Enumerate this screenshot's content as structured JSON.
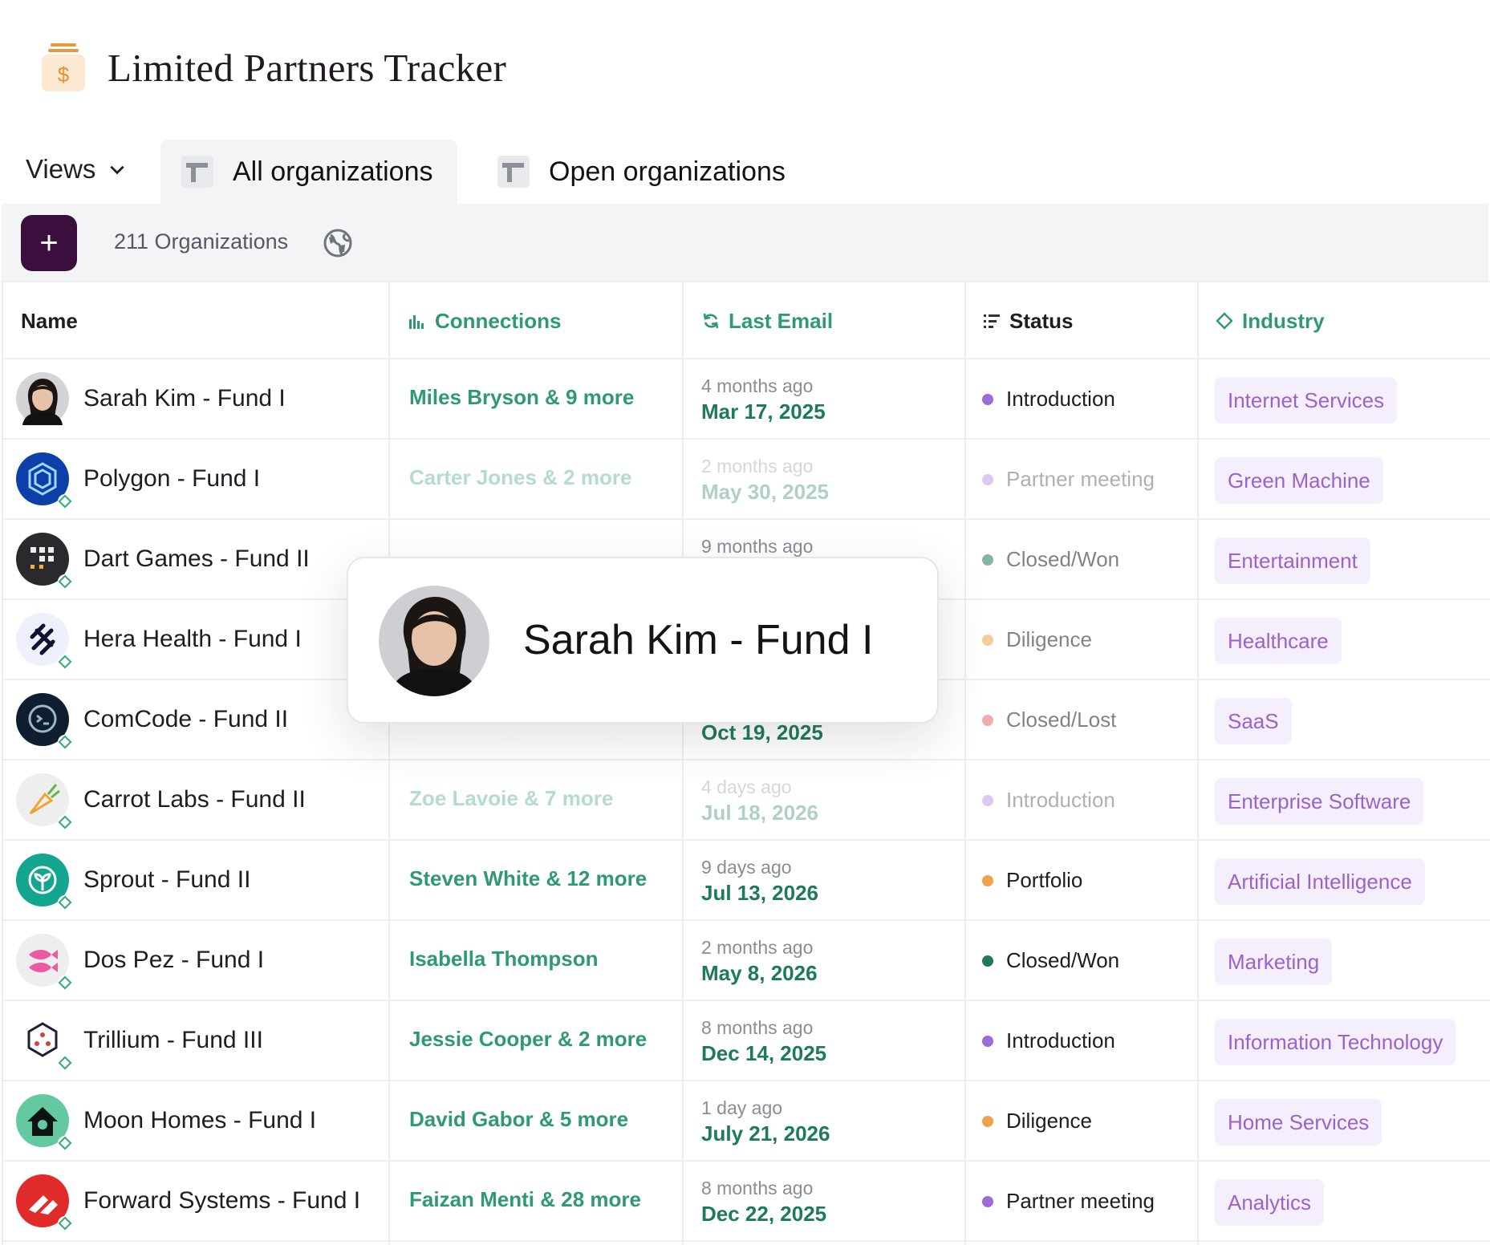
{
  "app": {
    "title": "Limited Partners Tracker",
    "icon": "money-bag-icon"
  },
  "tabs": {
    "views_label": "Views",
    "items": [
      {
        "label": "All organizations",
        "active": true
      },
      {
        "label": "Open organizations",
        "active": false
      }
    ]
  },
  "toolbar": {
    "add_label": "+",
    "count": "211 Organizations",
    "icon": "globe-icon"
  },
  "table": {
    "columns": [
      {
        "label": "Name",
        "icon": ""
      },
      {
        "label": "Connections",
        "icon": "bar-chart-icon"
      },
      {
        "label": "Last Email",
        "icon": "refresh-icon"
      },
      {
        "label": "Status",
        "icon": "list-status-icon"
      },
      {
        "label": "Industry",
        "icon": "diamond-icon"
      }
    ],
    "rows": [
      {
        "name": "Sarah Kim - Fund I",
        "connections": "Miles Bryson & 9 more",
        "relative": "4 months ago",
        "date": "Mar 17, 2025",
        "status": "Introduction",
        "status_color": "#9b6bd6",
        "industry": "Internet Services"
      },
      {
        "name": "Polygon - Fund I",
        "connections": "Carter Jones & 2 more",
        "relative": "2 months ago",
        "date": "May 30, 2025",
        "status": "Partner meeting",
        "status_color": "#9b6bd6",
        "industry": "Green Machine"
      },
      {
        "name": "Dart Games - Fund II",
        "connections": "",
        "relative": "9 months ago",
        "date": "",
        "status": "Closed/Won",
        "status_color": "#1f7a55",
        "industry": "Entertainment"
      },
      {
        "name": "Hera Health - Fund I",
        "connections": "",
        "relative": "",
        "date": "",
        "status": "Diligence",
        "status_color": "#f0a24a",
        "industry": "Healthcare"
      },
      {
        "name": "ComCode - Fund II",
        "connections": "",
        "relative": "",
        "date": "Oct 19, 2025",
        "status": "Closed/Lost",
        "status_color": "#e56a6a",
        "industry": "SaaS"
      },
      {
        "name": "Carrot Labs - Fund II",
        "connections": "Zoe Lavoie & 7 more",
        "relative": "4 days ago",
        "date": "Jul 18, 2026",
        "status": "Introduction",
        "status_color": "#9b6bd6",
        "industry": "Enterprise Software"
      },
      {
        "name": "Sprout - Fund II",
        "connections": "Steven White & 12 more",
        "relative": "9 days ago",
        "date": "Jul 13, 2026",
        "status": "Portfolio",
        "status_color": "#f0a24a",
        "industry": "Artificial Intelligence"
      },
      {
        "name": "Dos Pez - Fund I",
        "connections": "Isabella Thompson",
        "relative": "2 months ago",
        "date": "May 8, 2026",
        "status": "Closed/Won",
        "status_color": "#1f7a55",
        "industry": "Marketing"
      },
      {
        "name": "Trillium - Fund III",
        "connections": "Jessie Cooper & 2 more",
        "relative": "8 months ago",
        "date": "Dec 14, 2025",
        "status": "Introduction",
        "status_color": "#9b6bd6",
        "industry": "Information Technology"
      },
      {
        "name": "Moon Homes - Fund I",
        "connections": "David Gabor & 5 more",
        "relative": "1 day ago",
        "date": "July 21, 2026",
        "status": "Diligence",
        "status_color": "#f0a24a",
        "industry": "Home Services"
      },
      {
        "name": "Forward Systems - Fund I",
        "connections": "Faizan Menti & 28 more",
        "relative": "8 months ago",
        "date": "Dec 22, 2025",
        "status": "Partner meeting",
        "status_color": "#9b6bd6",
        "industry": "Analytics"
      }
    ]
  },
  "popover": {
    "name": "Sarah Kim - Fund I"
  }
}
